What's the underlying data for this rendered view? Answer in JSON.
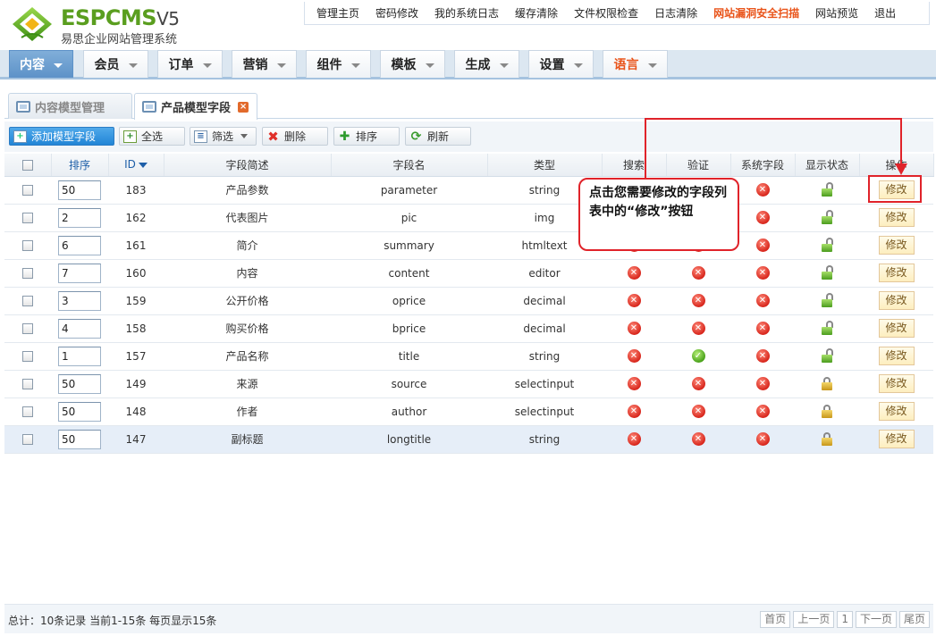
{
  "logo": {
    "brand": "ESPCMS",
    "version": "V5",
    "subtitle": "易思企业网站管理系统"
  },
  "topnav": [
    {
      "label": "管理主页"
    },
    {
      "label": "密码修改"
    },
    {
      "label": "我的系统日志"
    },
    {
      "label": "缓存清除"
    },
    {
      "label": "文件权限检查"
    },
    {
      "label": "日志清除"
    },
    {
      "label": "网站漏洞安全扫描"
    },
    {
      "label": "网站预览"
    },
    {
      "label": "退出"
    }
  ],
  "mainmenu": [
    {
      "label": "内容"
    },
    {
      "label": "会员"
    },
    {
      "label": "订单"
    },
    {
      "label": "营销"
    },
    {
      "label": "组件"
    },
    {
      "label": "模板"
    },
    {
      "label": "生成"
    },
    {
      "label": "设置"
    },
    {
      "label": "语言"
    }
  ],
  "tabs": [
    {
      "label": "内容模型管理"
    },
    {
      "label": "产品模型字段",
      "close": "×"
    }
  ],
  "toolbar": {
    "add": "添加模型字段",
    "select_all": "全选",
    "filter": "筛选",
    "delete": "删除",
    "sort": "排序",
    "refresh": "刷新"
  },
  "table": {
    "headers": {
      "sort": "排序",
      "id": "ID",
      "desc": "字段简述",
      "name": "字段名",
      "type": "类型",
      "search": "搜索",
      "verify": "验证",
      "system": "系统字段",
      "status": "显示状态",
      "action": "操作"
    },
    "edit_label": "修改",
    "rows": [
      {
        "sort": "50",
        "id": "183",
        "desc": "产品参数",
        "name": "parameter",
        "type": "string",
        "verify": false,
        "lock": "open"
      },
      {
        "sort": "2",
        "id": "162",
        "desc": "代表图片",
        "name": "pic",
        "type": "img",
        "verify": false,
        "lock": "open"
      },
      {
        "sort": "6",
        "id": "161",
        "desc": "简介",
        "name": "summary",
        "type": "htmltext",
        "verify": false,
        "lock": "open"
      },
      {
        "sort": "7",
        "id": "160",
        "desc": "内容",
        "name": "content",
        "type": "editor",
        "verify": false,
        "lock": "open"
      },
      {
        "sort": "3",
        "id": "159",
        "desc": "公开价格",
        "name": "oprice",
        "type": "decimal",
        "verify": false,
        "lock": "open"
      },
      {
        "sort": "4",
        "id": "158",
        "desc": "购买价格",
        "name": "bprice",
        "type": "decimal",
        "verify": false,
        "lock": "open"
      },
      {
        "sort": "1",
        "id": "157",
        "desc": "产品名称",
        "name": "title",
        "type": "string",
        "verify": true,
        "lock": "open"
      },
      {
        "sort": "50",
        "id": "149",
        "desc": "来源",
        "name": "source",
        "type": "selectinput",
        "verify": false,
        "lock": "closed"
      },
      {
        "sort": "50",
        "id": "148",
        "desc": "作者",
        "name": "author",
        "type": "selectinput",
        "verify": false,
        "lock": "closed"
      },
      {
        "sort": "50",
        "id": "147",
        "desc": "副标题",
        "name": "longtitle",
        "type": "string",
        "verify": false,
        "lock": "closed"
      }
    ]
  },
  "annotation": {
    "text": "点击您需要修改的字段列表中的“修改”按钮"
  },
  "footer": {
    "stats": "总计：10条记录 当前1-15条 每页显示15条",
    "pager": [
      "首页",
      "上一页",
      "1",
      "下一页",
      "尾页"
    ]
  },
  "colors": {
    "accent": "#2285d6",
    "danger": "#e0232a",
    "brand": "#5a9e1f",
    "highlight": "#e9541a"
  }
}
